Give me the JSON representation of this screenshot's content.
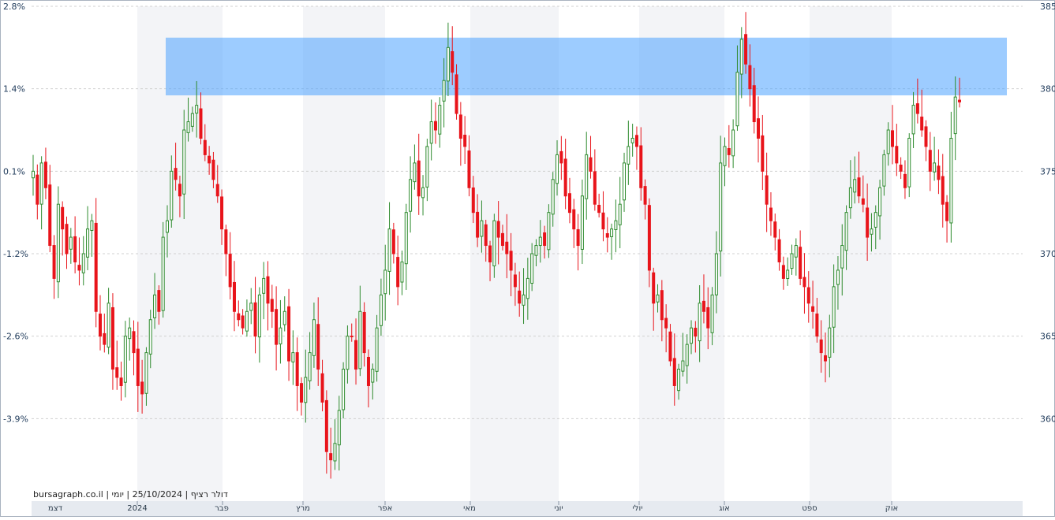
{
  "caption": "bursagraph.co.il | דולר רציף | 25/10/2024 | יומי",
  "colors": {
    "up": "#2e8b2e",
    "down": "#e8141b",
    "band": "#4da3ff",
    "gridline": "#d0d0d0",
    "shade": "#f3f4f7",
    "border": "#a9b3bf",
    "axisText": "#1f3a5a"
  },
  "chart_data": {
    "type": "candlestick",
    "title": "",
    "xlabel": "",
    "ylabel": "",
    "y_left_ticks": [
      "2.8%",
      "1.4%",
      "0.1%",
      "-1.2%",
      "-2.6%",
      "-3.9%"
    ],
    "y_right_ticks": [
      385,
      380,
      375,
      370,
      365,
      360
    ],
    "y_right_range": [
      355,
      385
    ],
    "x_months": [
      "דצמ",
      "2024",
      "פבר",
      "מרץ",
      "אפר",
      "מאי",
      "יוני",
      "יולי",
      "אוג",
      "ספט",
      "אוק"
    ],
    "resistance_zone": {
      "from": 379.6,
      "to": 383.1
    },
    "closes": [
      375.0,
      373.0,
      375.5,
      374.0,
      370.5,
      368.5,
      373.0,
      371.5,
      370.0,
      371.0,
      369.5,
      369.0,
      370.0,
      371.5,
      372.0,
      366.5,
      365.0,
      364.5,
      367.0,
      363.0,
      362.5,
      362.0,
      365.0,
      365.5,
      364.0,
      362.0,
      361.5,
      364.0,
      366.0,
      367.5,
      366.5,
      371.0,
      372.0,
      375.0,
      374.5,
      373.5,
      377.5,
      378.0,
      378.5,
      379.0,
      377.0,
      376.0,
      375.5,
      374.5,
      373.5,
      371.5,
      370.0,
      368.0,
      366.5,
      366.0,
      365.5,
      366.5,
      367.0,
      365.0,
      367.5,
      368.5,
      367.0,
      366.5,
      364.5,
      365.5,
      366.5,
      363.5,
      364.0,
      362.0,
      361.0,
      362.5,
      364.0,
      366.0,
      363.0,
      361.0,
      358.0,
      357.5,
      358.5,
      360.5,
      363.0,
      365.0,
      365.0,
      363.0,
      366.5,
      364.0,
      362.0,
      363.0,
      365.5,
      367.5,
      369.0,
      371.5,
      370.0,
      368.0,
      369.5,
      372.5,
      374.5,
      375.5,
      373.5,
      374.0,
      376.5,
      378.0,
      377.5,
      379.0,
      380.5,
      382.5,
      381.0,
      378.5,
      377.0,
      376.5,
      374.0,
      372.5,
      371.0,
      372.0,
      370.5,
      369.5,
      372.0,
      371.0,
      370.5,
      370.0,
      369.0,
      368.0,
      367.0,
      367.5,
      368.5,
      370.0,
      370.5,
      371.0,
      370.5,
      372.5,
      374.5,
      376.0,
      375.5,
      373.5,
      372.5,
      371.5,
      370.5,
      373.5,
      376.0,
      375.0,
      373.0,
      372.5,
      371.5,
      371.0,
      371.5,
      372.0,
      373.0,
      375.5,
      376.5,
      377.0,
      376.5,
      374.0,
      373.0,
      369.0,
      367.0,
      367.5,
      366.0,
      365.5,
      363.5,
      362.0,
      363.0,
      363.5,
      364.5,
      365.5,
      365.0,
      367.0,
      366.5,
      365.5,
      367.5,
      370.0,
      375.5,
      376.5,
      376.0,
      377.5,
      381.0,
      383.0,
      381.5,
      380.0,
      378.0,
      377.0,
      375.0,
      373.0,
      372.0,
      371.0,
      369.5,
      368.5,
      369.0,
      370.0,
      370.5,
      368.5,
      368.0,
      367.0,
      366.5,
      365.0,
      364.0,
      363.5,
      365.5,
      368.0,
      369.0,
      370.5,
      372.5,
      374.0,
      374.5,
      373.5,
      373.0,
      371.0,
      371.5,
      372.5,
      374.0,
      376.0,
      377.5,
      376.5,
      375.5,
      375.0,
      374.0,
      377.0,
      379.0,
      378.5,
      377.5,
      376.5,
      375.0,
      375.5,
      374.5,
      373.0,
      372.0,
      377.0,
      379.5,
      379.2
    ]
  }
}
